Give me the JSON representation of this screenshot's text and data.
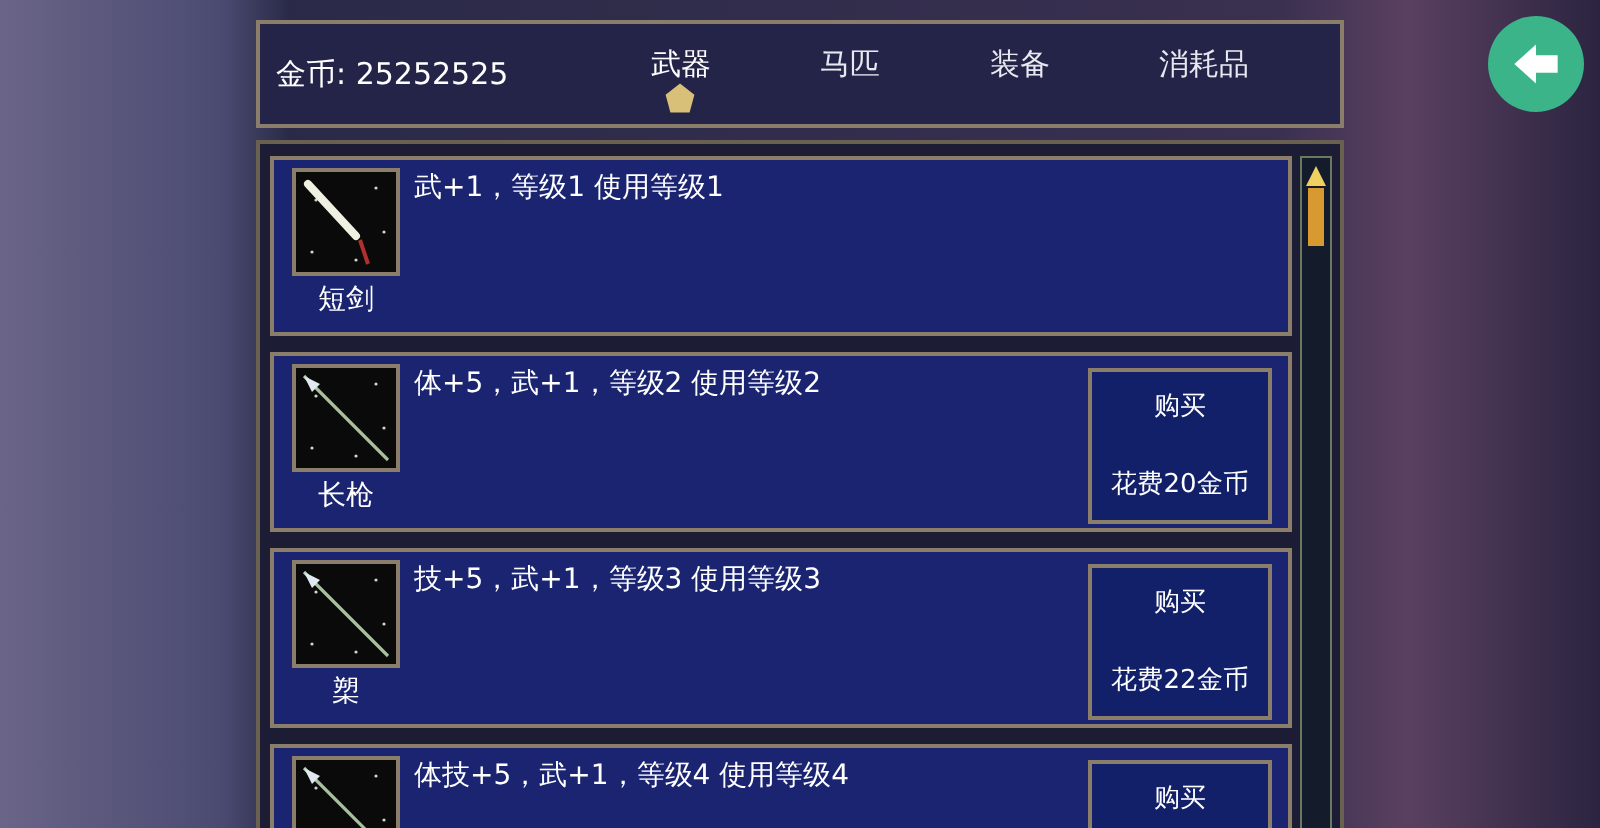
{
  "gold": {
    "label": "金币: 25252525"
  },
  "tabs": [
    {
      "label": "武器",
      "selected": true
    },
    {
      "label": "马匹",
      "selected": false
    },
    {
      "label": "装备",
      "selected": false
    },
    {
      "label": "消耗品",
      "selected": false
    }
  ],
  "items": [
    {
      "name": "短剑",
      "description": "武+1，等级1 使用等级1",
      "kind": "sword"
    },
    {
      "name": "长枪",
      "description": "体+5，武+1，等级2 使用等级2",
      "kind": "spear",
      "buy": {
        "label": "购买",
        "price": "花费20金币"
      }
    },
    {
      "name": "槊",
      "description": "技+5，武+1，等级3 使用等级3",
      "kind": "spear",
      "buy": {
        "label": "购买",
        "price": "花费22金币"
      }
    },
    {
      "description": "体技+5，武+1，等级4 使用等级4",
      "kind": "spear",
      "buy": {
        "label": "购买"
      }
    }
  ]
}
